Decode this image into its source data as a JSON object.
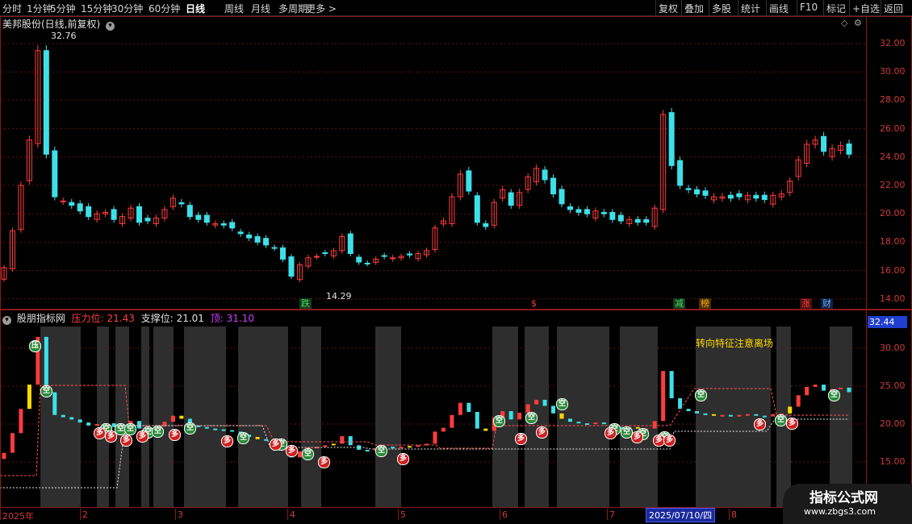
{
  "toolbar": {
    "left": [
      "分时",
      "1分钟",
      "5分钟",
      "15分钟",
      "30分钟",
      "60分钟",
      "日线",
      "周线",
      "月线",
      "多周期",
      "更多 >"
    ],
    "right": [
      "复权",
      "叠加",
      "多股",
      "统计",
      "画线",
      "F10",
      "标记",
      "+自选",
      "返回"
    ]
  },
  "main": {
    "title": "美邦股份(日线,前复权)",
    "high_label": "32.76",
    "low_label": "14.29",
    "y_ticks": [
      "32.00",
      "30.00",
      "28.00",
      "26.00",
      "24.00",
      "22.00",
      "20.00",
      "18.00",
      "16.00",
      "14.00"
    ],
    "events": [
      {
        "text": "跌",
        "color": "#38e068",
        "bg": "#1a3a1a"
      },
      {
        "text": "$",
        "color": "#ff4040",
        "bg": ""
      },
      {
        "text": "减",
        "color": "#38e068",
        "bg": "#1a3a1a"
      },
      {
        "text": "榜",
        "color": "#ffb020",
        "bg": "#4a3000"
      },
      {
        "text": "涨",
        "color": "#ff4040",
        "bg": "#4a1010"
      },
      {
        "text": "财",
        "color": "#6ab0ff",
        "bg": "#102040"
      }
    ]
  },
  "indicator": {
    "name": "股朋指标网",
    "pressure_label": "压力位: 21.43",
    "support_label": "支撑位: 21.01",
    "top_label": "顶: 31.10",
    "y_ticks": [
      "30.00",
      "25.00",
      "20.00",
      "15.00"
    ],
    "current_value": "32.44",
    "annotation": "转向特征注意离场",
    "badge_kong": "空",
    "badge_duo": "多",
    "badge_ya": "压"
  },
  "dates": [
    "2025年",
    "2",
    "3",
    "4",
    "5",
    "6",
    "7",
    "8"
  ],
  "selected_date": "2025/07/10/四",
  "watermark": {
    "title": "指标公式网",
    "url": "www.zbgs3.com"
  },
  "colors": {
    "up": "#ff3c3c",
    "down": "#3de0e8",
    "grid": "#6a1010",
    "pressure": "#ff5050",
    "support": "#e8e8e8",
    "band": "#2e2e2e",
    "yellow": "#ffd800"
  }
}
